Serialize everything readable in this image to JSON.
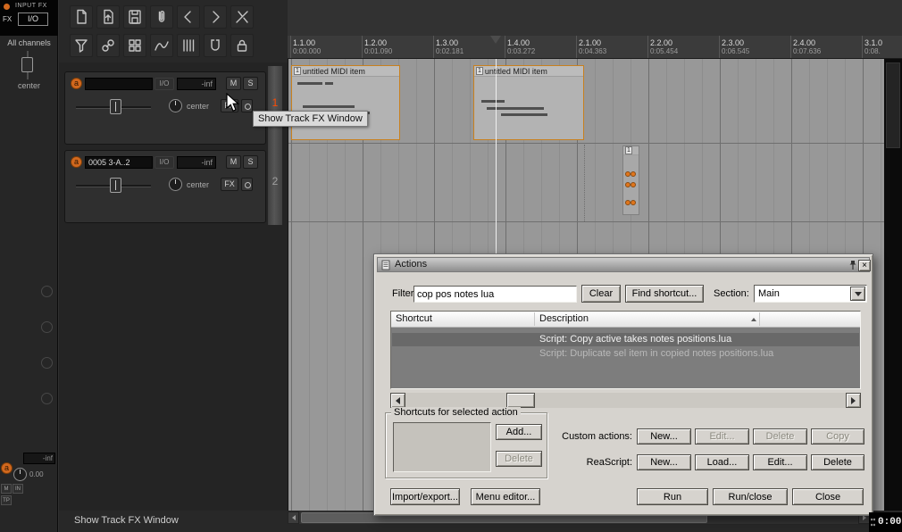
{
  "master": {
    "input_fx": "INPUT FX",
    "fx": "FX",
    "io": "I/O",
    "all_channels": "All channels",
    "pan_label": "center",
    "arm": "a",
    "vol_readout": "-inf",
    "pan_readout": "0.00",
    "mute": "M",
    "in": "IN",
    "tp": "TP"
  },
  "toolbar": {
    "row1_icons": [
      "new-project",
      "open-project",
      "save-project",
      "project-settings",
      "undo",
      "redo",
      "action-list"
    ],
    "row2_icons": [
      "filter",
      "grouping",
      "docker",
      "envelopes",
      "grid",
      "snap",
      "lock"
    ]
  },
  "tcp": {
    "tracks": [
      {
        "number": "1",
        "arm": "a",
        "name": "",
        "io": "I/O",
        "vol": "-inf",
        "mute": "M",
        "solo": "S",
        "pan": "center",
        "fx": "FX"
      },
      {
        "number": "2",
        "arm": "a",
        "name": "0005 3-A..2",
        "io": "I/O",
        "vol": "-inf",
        "mute": "M",
        "solo": "S",
        "pan": "center",
        "fx": "FX"
      }
    ]
  },
  "ruler": {
    "ticks": [
      {
        "beat": "1.1.00",
        "time": "0:00.000"
      },
      {
        "beat": "1.2.00",
        "time": "0:01.090"
      },
      {
        "beat": "1.3.00",
        "time": "0:02.181"
      },
      {
        "beat": "1.4.00",
        "time": "0:03.272"
      },
      {
        "beat": "2.1.00",
        "time": "0:04.363"
      },
      {
        "beat": "2.2.00",
        "time": "0:05.454"
      },
      {
        "beat": "2.3.00",
        "time": "0:06.545"
      },
      {
        "beat": "2.4.00",
        "time": "0:07.636"
      },
      {
        "beat": "3.1.0",
        "time": "0:08."
      }
    ]
  },
  "arrange": {
    "items": [
      {
        "badge": "1",
        "title": "untitled MIDI item"
      },
      {
        "badge": "1",
        "title": "untitled MIDI item"
      }
    ],
    "pooled_badge": "1"
  },
  "tooltip": {
    "text": "Show Track FX Window"
  },
  "actions": {
    "title": "Actions",
    "close_x": "×",
    "filter_label": "Filter:",
    "filter_value": "cop pos notes lua",
    "clear": "Clear",
    "find_shortcut": "Find shortcut...",
    "section_label": "Section:",
    "section_value": "Main",
    "col_shortcut": "Shortcut",
    "col_description": "Description",
    "rows": [
      {
        "shortcut": "",
        "description": "Script: Copy active takes notes positions.lua",
        "selected": true
      },
      {
        "shortcut": "",
        "description": "Script: Duplicate sel item in copied notes positions.lua",
        "selected": false
      }
    ],
    "group_title": "Shortcuts for selected action",
    "add": "Add...",
    "delete": "Delete",
    "custom_label": "Custom actions:",
    "custom_new": "New...",
    "custom_edit": "Edit...",
    "custom_delete": "Delete",
    "custom_copy": "Copy",
    "reascript_label": "ReaScript:",
    "rs_new": "New...",
    "rs_load": "Load...",
    "rs_edit": "Edit...",
    "rs_delete": "Delete",
    "import_export": "Import/export...",
    "menu_editor": "Menu editor...",
    "run": "Run",
    "run_close": "Run/close",
    "close": "Close"
  },
  "status_bar": {
    "text": "Show Track FX Window"
  },
  "transport": {
    "time": "0:00"
  },
  "colors": {
    "accent_orange": "#d1681e",
    "item_selected_border": "#c8801e",
    "track_number_active": "#ff4a00",
    "dialog_bg": "#d6d3ce"
  }
}
